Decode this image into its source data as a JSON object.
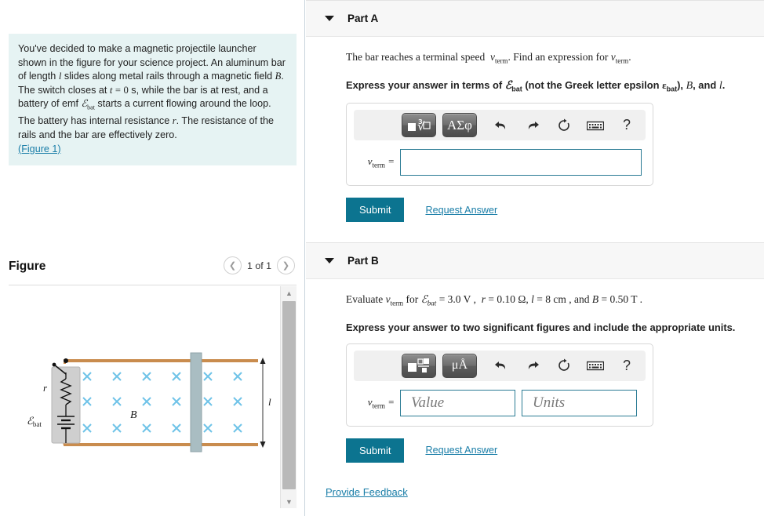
{
  "problem": {
    "text": "You've decided to make a magnetic projectile launcher shown in the figure for your science project. An aluminum bar of length l slides along metal rails through a magnetic field B. The switch closes at t = 0 s, while the bar is at rest, and a battery of emf Ebat starts a current flowing around the loop. The battery has internal resistance r. The resistance of the rails and the bar are effectively zero.",
    "figure_link": "(Figure 1)"
  },
  "figure": {
    "title": "Figure",
    "counter": "1 of 1",
    "prev_icon": "chevron-left-icon",
    "next_icon": "chevron-right-icon",
    "labels": {
      "resistance": "r",
      "emf": "ℰbat",
      "field": "B",
      "length": "l"
    },
    "colors": {
      "rail": "#c98c4e",
      "field_mark": "#6fc3e8",
      "bar": "#a9bdc2",
      "battery_box": "#cfcfcf"
    }
  },
  "partA": {
    "label": "Part A",
    "caret_icon": "caret-down-icon",
    "question": "The bar reaches a terminal speed v_term. Find an expression for v_term.",
    "instruction": "Express your answer in terms of ℰbat (not the Greek letter epsilon εbat), B, and l.",
    "var_label": "v",
    "var_sub": "term",
    "equals": "=",
    "answer_value": "",
    "answer_placeholder": "",
    "toolbar": {
      "template_icon": "math-template-icon",
      "greek_label": "ΑΣφ",
      "undo_icon": "undo-icon",
      "redo_icon": "redo-icon",
      "reset_icon": "reset-icon",
      "keyboard_icon": "keyboard-icon",
      "help_icon": "help-icon"
    },
    "submit_label": "Submit",
    "request_answer_label": "Request Answer"
  },
  "partB": {
    "label": "Part B",
    "caret_icon": "caret-down-icon",
    "question": "Evaluate v_term for ℰbat = 3.0 V, r = 0.10 Ω, l = 8 cm, and B = 0.50 T.",
    "values": {
      "emf": "3.0 V",
      "resistance": "0.10 Ω",
      "length": "8 cm",
      "field": "0.50 T"
    },
    "instruction": "Express your answer to two significant figures and include the appropriate units.",
    "var_label": "v",
    "var_sub": "term",
    "equals": "=",
    "value_placeholder": "Value",
    "units_placeholder": "Units",
    "toolbar": {
      "template_icon": "units-template-icon",
      "units_label": "μÅ",
      "undo_icon": "undo-icon",
      "redo_icon": "redo-icon",
      "reset_icon": "reset-icon",
      "keyboard_icon": "keyboard-icon",
      "help_icon": "help-icon"
    },
    "submit_label": "Submit",
    "request_answer_label": "Request Answer"
  },
  "footer": {
    "feedback_label": "Provide Feedback"
  },
  "theme": {
    "accent": "#0c7490",
    "link": "#1a7ea8",
    "problem_bg": "#e6f3f3"
  }
}
